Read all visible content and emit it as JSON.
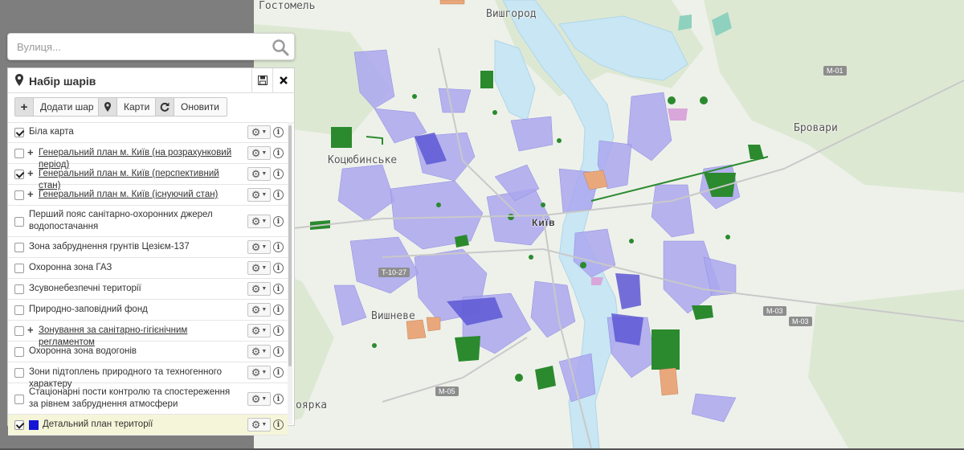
{
  "colors": {
    "accent": "#1515d6",
    "zone_lilac": "#a9a6ee",
    "zone_blue": "#6a64d8",
    "green_space": "#2a8a2a",
    "orange_zone": "#e7a679",
    "river": "#c8e6f3"
  },
  "search": {
    "placeholder": "Вулиця..."
  },
  "panel": {
    "title": "Набір шарів",
    "icons": {
      "title": "map-marker-icon",
      "save": "save-icon",
      "close": "close-icon"
    },
    "toolbar": [
      {
        "icon": "plus-icon",
        "label": "Додати шар"
      },
      {
        "icon": "map-marker-icon",
        "label": "Карти"
      },
      {
        "icon": "refresh-icon",
        "label": "Оновити"
      }
    ],
    "layers": [
      {
        "label": "Біла карта",
        "checked": true,
        "expandable": false,
        "link": false
      },
      {
        "label": "Генеральний план м. Київ (на розрахунковий період)",
        "checked": false,
        "expandable": true,
        "link": true
      },
      {
        "label": "Генеральний план м. Київ (перспективний стан)",
        "checked": true,
        "expandable": true,
        "link": true
      },
      {
        "label": "Генеральний план м. Київ (існуючий стан)",
        "checked": false,
        "expandable": true,
        "link": true
      },
      {
        "label": "Перший пояс санітарно-охоронних джерел водопостачання",
        "checked": false,
        "expandable": false,
        "link": false
      },
      {
        "label": "Зона забруднення грунтів Цезієм-137",
        "checked": false,
        "expandable": false,
        "link": false
      },
      {
        "label": "Охоронна зона ГАЗ",
        "checked": false,
        "expandable": false,
        "link": false
      },
      {
        "label": "Зсувонебезпечні території",
        "checked": false,
        "expandable": false,
        "link": false
      },
      {
        "label": "Природно-заповідний фонд",
        "checked": false,
        "expandable": false,
        "link": false
      },
      {
        "label": "Зонування за санітарно-гігієнічним регламентом",
        "checked": false,
        "expandable": true,
        "link": true
      },
      {
        "label": "Охоронна зона водогонів",
        "checked": false,
        "expandable": false,
        "link": false
      },
      {
        "label": "Зони підтоплень природного та техногенного характеру",
        "checked": false,
        "expandable": false,
        "link": false
      },
      {
        "label": "Стаціонарні пости контролю та спостереження за рівнем забруднення атмосфери",
        "checked": false,
        "expandable": false,
        "link": false
      },
      {
        "label": "Детальний план території",
        "checked": true,
        "expandable": false,
        "link": false,
        "swatch": "#1515d6"
      }
    ],
    "row_actions": {
      "settings_icon": "gear-icon",
      "dropdown_icon": "caret-down-icon",
      "info_icon": "info-icon"
    }
  },
  "map": {
    "places": {
      "hostomel": "Гостомель",
      "vyshhorod": "Вишгород",
      "brovary": "Бровари",
      "kotsiubynske": "Коцюбинське",
      "kyiv": "Київ",
      "vyshneve": "Вишневе",
      "boiarka": "оярка"
    },
    "roads": {
      "m01": "M-01",
      "t1027": "T-10-27",
      "m03": "M-03",
      "m03b": "M-03",
      "m05": "M-05"
    }
  }
}
